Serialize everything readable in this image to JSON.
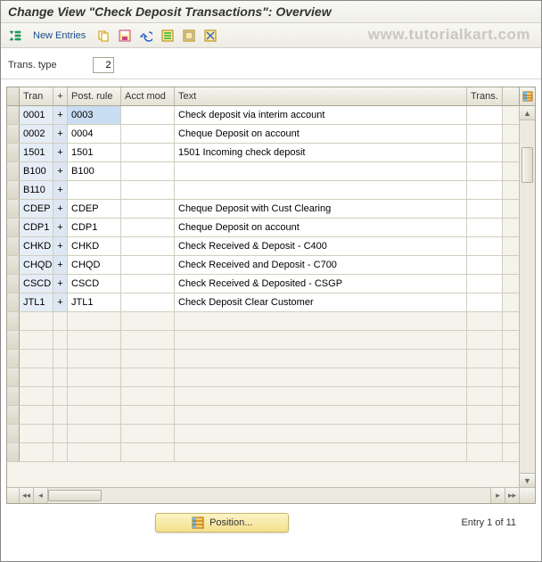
{
  "title": "Change View \"Check Deposit Transactions\": Overview",
  "toolbar": {
    "new_entries": "New Entries"
  },
  "filter": {
    "label": "Trans. type",
    "value": "2"
  },
  "watermark": "www.tutorialkart.com",
  "grid": {
    "headers": {
      "rowsel": "",
      "tran": "Tran",
      "plus": "+",
      "rule": "Post. rule",
      "acct": "Acct mod",
      "text": "Text",
      "trans": "Trans."
    },
    "rows": [
      {
        "tran": "0001",
        "plus": "+",
        "rule": "0003",
        "acct": "",
        "text": "Check deposit via interim account",
        "trans": "",
        "selected": true
      },
      {
        "tran": "0002",
        "plus": "+",
        "rule": "0004",
        "acct": "",
        "text": "Cheque Deposit on account",
        "trans": ""
      },
      {
        "tran": "1501",
        "plus": "+",
        "rule": "1501",
        "acct": "",
        "text": "1501 Incoming check deposit",
        "trans": ""
      },
      {
        "tran": "B100",
        "plus": "+",
        "rule": "B100",
        "acct": "",
        "text": "",
        "trans": ""
      },
      {
        "tran": "B110",
        "plus": "+",
        "rule": "",
        "acct": "",
        "text": "",
        "trans": ""
      },
      {
        "tran": "CDEP",
        "plus": "+",
        "rule": "CDEP",
        "acct": "",
        "text": "Cheque Deposit with Cust Clearing",
        "trans": ""
      },
      {
        "tran": "CDP1",
        "plus": "+",
        "rule": "CDP1",
        "acct": "",
        "text": "Cheque Deposit on account",
        "trans": ""
      },
      {
        "tran": "CHKD",
        "plus": "+",
        "rule": "CHKD",
        "acct": "",
        "text": "Check Received & Deposit - C400",
        "trans": ""
      },
      {
        "tran": "CHQD",
        "plus": "+",
        "rule": "CHQD",
        "acct": "",
        "text": "Check Received and Deposit - C700",
        "trans": ""
      },
      {
        "tran": "CSCD",
        "plus": "+",
        "rule": "CSCD",
        "acct": "",
        "text": "Check Received & Deposited - CSGP",
        "trans": ""
      },
      {
        "tran": "JTL1",
        "plus": "+",
        "rule": "JTL1",
        "acct": "",
        "text": "Check Deposit Clear Customer",
        "trans": ""
      }
    ],
    "empty_rows": 8
  },
  "footer": {
    "position": "Position...",
    "entry": "Entry 1 of 11"
  }
}
